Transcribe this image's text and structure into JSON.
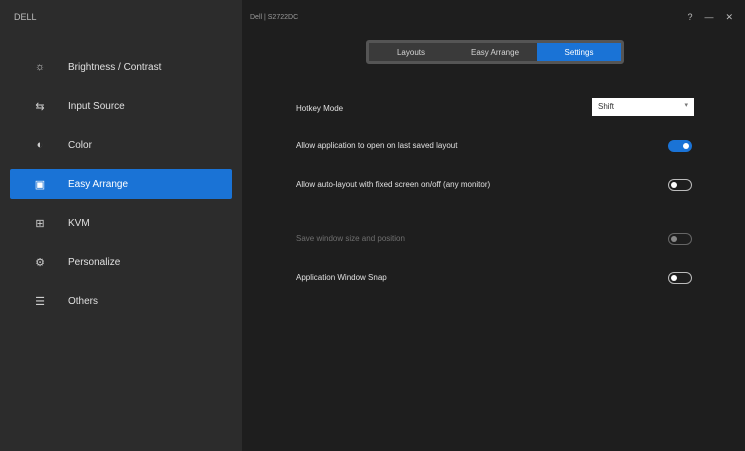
{
  "sidebar": {
    "logo": "DELL",
    "items": [
      {
        "label": "Brightness / Contrast",
        "icon": "brightness-icon"
      },
      {
        "label": "Input Source",
        "icon": "input-source-icon"
      },
      {
        "label": "Color",
        "icon": "color-icon"
      },
      {
        "label": "Easy Arrange",
        "icon": "easy-arrange-icon",
        "active": true
      },
      {
        "label": "KVM",
        "icon": "kvm-icon"
      },
      {
        "label": "Personalize",
        "icon": "personalize-icon"
      },
      {
        "label": "Others",
        "icon": "others-icon"
      }
    ]
  },
  "header": {
    "title": "Dell | S2722DC"
  },
  "tabs": [
    {
      "label": "Layouts"
    },
    {
      "label": "Easy Arrange"
    },
    {
      "label": "Settings",
      "active": true
    }
  ],
  "settings": {
    "hotkey_label": "Hotkey Mode",
    "hotkey_value": "Shift",
    "row1": "Allow application to open on last saved layout",
    "row2": "Allow auto-layout with fixed screen on/off (any monitor)",
    "row3": "Save window size and position",
    "row4": "Application Window Snap"
  },
  "toggles": {
    "row1": "on",
    "row2": "off",
    "row3": "off-disabled",
    "row4": "off"
  },
  "colors": {
    "accent": "#1a73d6",
    "sidebar": "#2c2c2c",
    "background": "#1e1e1e"
  }
}
